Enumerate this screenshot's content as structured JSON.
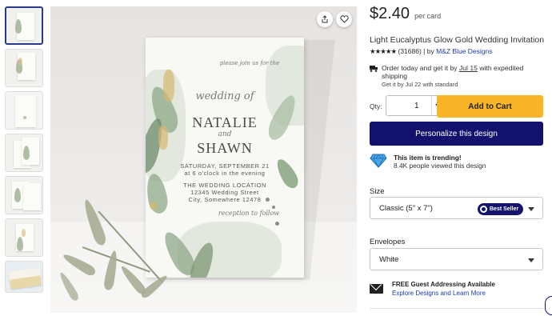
{
  "gallery": {
    "thumbnails": [
      {
        "label": "thumbnail-1",
        "selected": true
      },
      {
        "label": "thumbnail-2",
        "selected": false
      },
      {
        "label": "thumbnail-3",
        "selected": false
      },
      {
        "label": "thumbnail-4",
        "selected": false
      },
      {
        "label": "thumbnail-5",
        "selected": false
      },
      {
        "label": "thumbnail-6",
        "selected": false
      },
      {
        "label": "thumbnail-7",
        "selected": false
      }
    ],
    "share_icon": "share-icon",
    "favorite_icon": "heart-icon"
  },
  "invitation": {
    "intro": "please join us for the",
    "script_heading": "wedding of",
    "name1": "NATALIE",
    "and": "and",
    "name2": "SHAWN",
    "date": "SATURDAY, SEPTEMBER 21",
    "time": "at 6 o'clock in the evening",
    "location": "THE WEDDING LOCATION",
    "address1": "12345 Wedding Street",
    "address2": "City, Somewhere 12478",
    "reception": "reception to follow"
  },
  "product": {
    "price": "$2.40",
    "price_unit": "per card",
    "title": "Light Eucalyptus Glow Gold Wedding Invitation",
    "stars": "★★★★★",
    "rating_count": "(31686)",
    "by_text": "| by",
    "designer": "M&Z Blue Designs"
  },
  "shipping": {
    "line1_prefix": "Order today and get it by",
    "line1_date": "Jul 15",
    "line1_suffix": "with expedited",
    "line1_cont": "shipping",
    "line2": "Get it by Jul 22 with standard"
  },
  "purchase": {
    "qty_label": "Qty:",
    "qty_value": "1",
    "add_to_cart": "Add to Cart",
    "personalize": "Personalize this design"
  },
  "trending": {
    "title": "This item is trending!",
    "subtitle": "8.4K people viewed this design"
  },
  "size": {
    "label": "Size",
    "value": "Classic (5\" x 7\")",
    "badge": "Best Seller"
  },
  "envelopes": {
    "label": "Envelopes",
    "value": "White"
  },
  "guest": {
    "title": "FREE Guest Addressing Available",
    "link": "Explore Designs and Learn More"
  },
  "colors": {
    "primary": "#12126e",
    "accent": "#f7b527",
    "link": "#1c3fa8"
  }
}
